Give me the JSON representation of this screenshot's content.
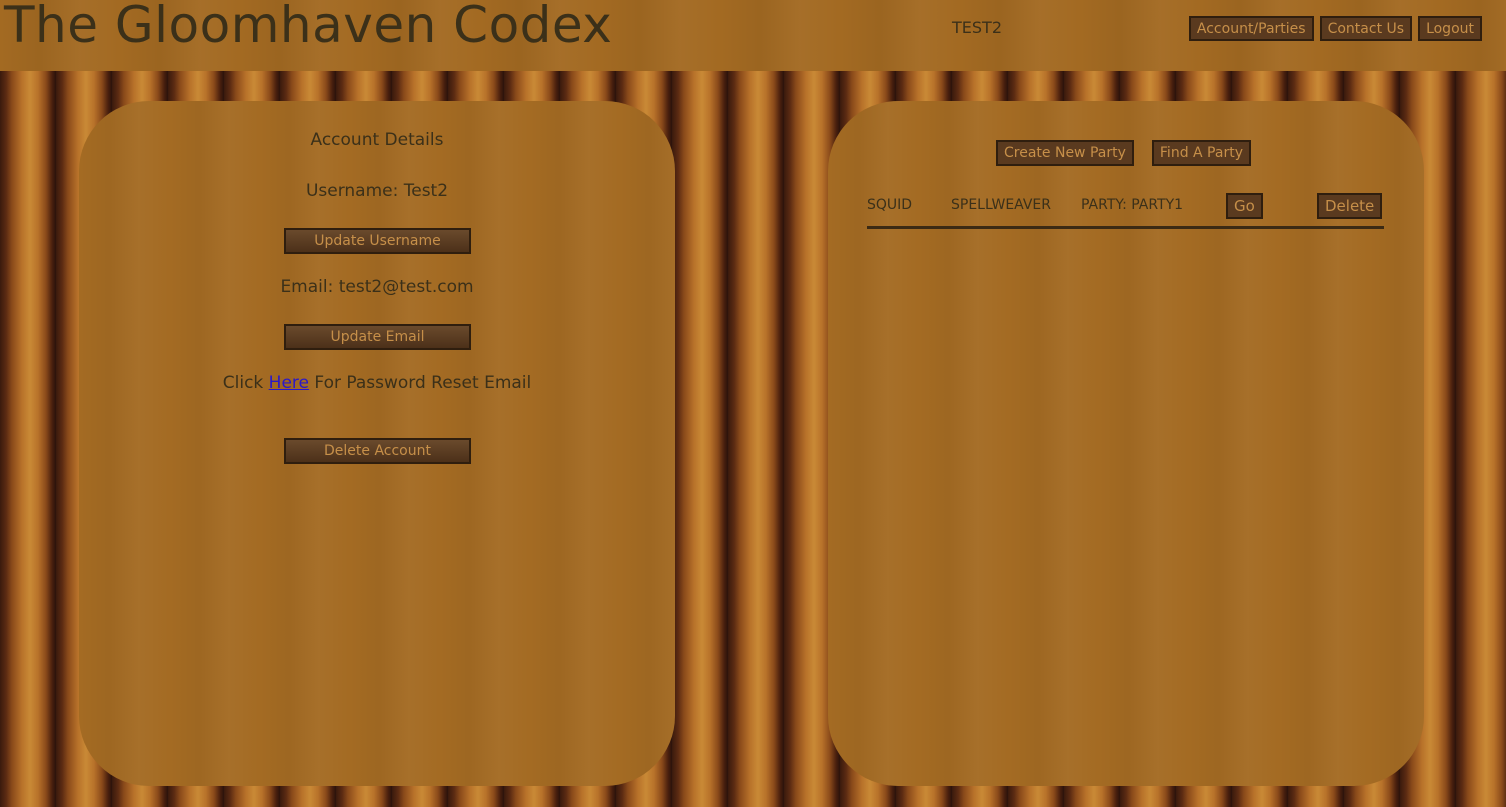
{
  "header": {
    "title": "The Gloomhaven Codex",
    "user": "TEST2",
    "nav": [
      "Account/Parties",
      "Contact Us",
      "Logout"
    ]
  },
  "account": {
    "heading": "Account Details",
    "username_text": "Username: Test2",
    "update_username": "Update Username",
    "email_text": "Email: test2@test.com",
    "update_email": "Update Email",
    "reset_prefix": "Click ",
    "reset_link": "Here",
    "reset_suffix": " For Password Reset Email",
    "delete_account": "Delete Account"
  },
  "parties": {
    "create_button": "Create New Party",
    "find_button": "Find A Party",
    "rows": [
      {
        "character": "SQUID",
        "class": "SPELLWEAVER",
        "party": "PARTY: PARTY1",
        "go": "Go",
        "delete": "Delete"
      }
    ]
  },
  "colors": {
    "wood_panel": "#a46b23",
    "button_bg": "#5a3a1f",
    "button_text": "#c68f49",
    "text": "#3b3019",
    "link": "#2a18c9"
  }
}
